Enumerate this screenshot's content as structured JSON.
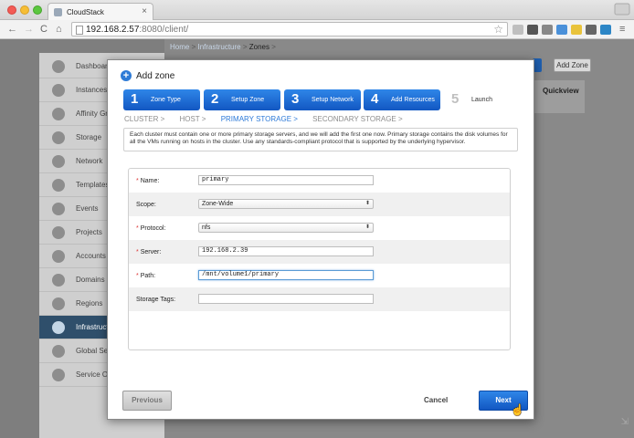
{
  "browser": {
    "tab_title": "CloudStack",
    "tab_close": "×",
    "url_host": "192.168.2.57",
    "url_rest": ":8080/client/",
    "back": "←",
    "forward": "→",
    "reload": "C",
    "home": "⌂",
    "star": "☆",
    "menu": "≡"
  },
  "breadcrumb": {
    "home": "Home",
    "sep1": ">",
    "infrastructure": "Infrastructure",
    "sep2": ">",
    "current": "Zones",
    "sep3": ">"
  },
  "header": {
    "add_zone_label": "Add Zone",
    "quickview": "Quickview"
  },
  "sidebar": {
    "items": [
      {
        "label": "Dashboard",
        "icon": "dashboard-icon"
      },
      {
        "label": "Instances",
        "icon": "cloud-icon"
      },
      {
        "label": "Affinity Gr",
        "icon": "affinity-icon"
      },
      {
        "label": "Storage",
        "icon": "storage-icon"
      },
      {
        "label": "Network",
        "icon": "network-icon"
      },
      {
        "label": "Templates",
        "icon": "templates-icon"
      },
      {
        "label": "Events",
        "icon": "events-icon"
      },
      {
        "label": "Projects",
        "icon": "projects-icon"
      },
      {
        "label": "Accounts",
        "icon": "accounts-icon"
      },
      {
        "label": "Domains",
        "icon": "domains-icon"
      },
      {
        "label": "Regions",
        "icon": "regions-icon"
      },
      {
        "label": "Infrastruct",
        "icon": "infrastructure-icon"
      },
      {
        "label": "Global Se",
        "icon": "global-settings-icon"
      },
      {
        "label": "Service O",
        "icon": "service-offerings-icon"
      }
    ],
    "active_index": 11
  },
  "modal": {
    "title": "Add zone",
    "steps": [
      {
        "num": "1",
        "label": "Zone Type",
        "active": true
      },
      {
        "num": "2",
        "label": "Setup Zone",
        "active": true
      },
      {
        "num": "3",
        "label": "Setup Network",
        "active": true
      },
      {
        "num": "4",
        "label": "Add Resources",
        "active": true
      },
      {
        "num": "5",
        "label": "Launch",
        "active": false
      }
    ],
    "substeps": {
      "cluster": "CLUSTER >",
      "host": "HOST >",
      "primary": "PRIMARY STORAGE >",
      "secondary": "SECONDARY STORAGE >"
    },
    "info_text": "Each cluster must contain one or more primary storage servers, and we will add the first one now. Primary storage contains the disk volumes for all the VMs running on hosts in the cluster. Use any standards-compliant protocol that is supported by the underlying hypervisor.",
    "form": {
      "name_label": "Name:",
      "name_value": "primary",
      "scope_label": "Scope:",
      "scope_value": "Zone-Wide",
      "protocol_label": "Protocol:",
      "protocol_value": "nfs",
      "server_label": "Server:",
      "server_value": "192.168.2.39",
      "path_label": "Path:",
      "path_value": "/mnt/volume1/primary",
      "tags_label": "Storage Tags:",
      "tags_value": "",
      "required_mark": "*",
      "select_arrow": "⬍"
    },
    "buttons": {
      "previous": "Previous",
      "cancel": "Cancel",
      "next": "Next"
    }
  },
  "colors": {
    "step_blue": "#1f6fd8",
    "active_substep": "#2d7ad8",
    "required": "#dd3333",
    "sidebar_active": "#2f4f6b"
  }
}
